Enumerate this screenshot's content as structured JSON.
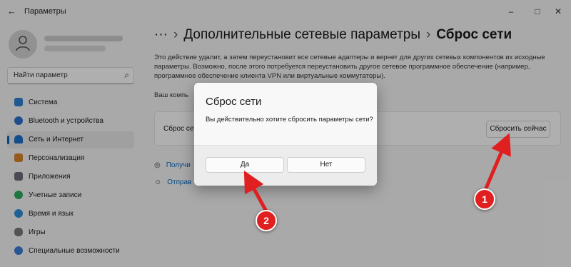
{
  "window": {
    "title": "Параметры",
    "back_glyph": "←",
    "minimize_glyph": "–",
    "maximize_glyph": "□",
    "close_glyph": "✕"
  },
  "sidebar": {
    "search_placeholder": "Найти параметр",
    "items": [
      {
        "label": "Система",
        "icon": "monitor-icon",
        "color": "#2f7fd1"
      },
      {
        "label": "Bluetooth и устройства",
        "icon": "bluetooth-icon",
        "color": "#2a70c8"
      },
      {
        "label": "Сеть и Интернет",
        "icon": "wifi-icon",
        "color": "#1d6fc9",
        "active": true
      },
      {
        "label": "Персонализация",
        "icon": "brush-icon",
        "color": "#d9812a"
      },
      {
        "label": "Приложения",
        "icon": "apps-icon",
        "color": "#6b6b7a"
      },
      {
        "label": "Учетные записи",
        "icon": "person-icon",
        "color": "#2eaa5c"
      },
      {
        "label": "Время и язык",
        "icon": "globe-clock-icon",
        "color": "#2a8bd6"
      },
      {
        "label": "Игры",
        "icon": "gamepad-icon",
        "color": "#777777"
      },
      {
        "label": "Специальные возможности",
        "icon": "accessibility-icon",
        "color": "#3a7bd5"
      }
    ]
  },
  "main": {
    "breadcrumb": {
      "ellipsis": "···",
      "parent": "Дополнительные сетевые параметры",
      "separator": "›",
      "current": "Сброс сети"
    },
    "description": "Это действие удалит, а затем переустановит все сетевые адаптеры и вернет для других сетевых компонентов их исходные параметры. Возможно, после этого потребуется переустановить другое сетевое программное обеспечение (например, программное обеспечение клиента VPN или виртуальные коммутаторы).",
    "pc_text": "Ваш компь",
    "card": {
      "label": "Сброс сети",
      "button": "Сбросить сейчас"
    },
    "links": [
      {
        "label": "Получи",
        "icon": "help-icon"
      },
      {
        "label": "Отправ",
        "icon": "feedback-icon"
      }
    ]
  },
  "dialog": {
    "title": "Сброс сети",
    "text": "Вы действительно хотите сбросить параметры сети?",
    "yes": "Да",
    "no": "Нет"
  },
  "annotations": {
    "badge1": "1",
    "badge2": "2",
    "color": "#e02020"
  }
}
